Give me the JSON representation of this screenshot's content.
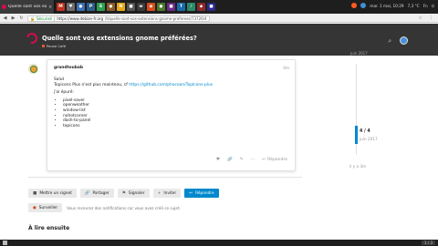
{
  "browser": {
    "tab_title": "Quelle sont vos extensions",
    "tab_close": "×",
    "pinned": [
      {
        "label": "M",
        "color": "#c23321"
      },
      {
        "label": "♥",
        "color": "#6d6d6d"
      },
      {
        "label": "●",
        "color": "#3c6eb4"
      },
      {
        "label": "P",
        "color": "#2d5f8a"
      },
      {
        "label": "S",
        "color": "#2e9e4f"
      },
      {
        "label": "●",
        "color": "#8a5a2a"
      },
      {
        "label": "N",
        "color": "#e6a817"
      },
      {
        "label": "■",
        "color": "#555555"
      },
      {
        "label": "w",
        "color": "#3a3a3a"
      },
      {
        "label": "◉",
        "color": "#d64d1a"
      },
      {
        "label": "●",
        "color": "#4a7a2a"
      },
      {
        "label": "■",
        "color": "#6a2a8a"
      },
      {
        "label": "T",
        "color": "#1a6aaa"
      },
      {
        "label": "♪",
        "color": "#2a8a6a"
      },
      {
        "label": "◆",
        "color": "#8a2a2a"
      },
      {
        "label": "■",
        "color": "#2a2a8a"
      }
    ],
    "status": {
      "clock": "mar. 1 mai, 10:29",
      "temperature": "7,3 °C",
      "layout": "Fn"
    },
    "back": "◀",
    "forward": "▶",
    "url_secure": "Sécurisé",
    "url_host": "https://www.debian-fr.org",
    "url_path": "/t/quelle-sont-vos-extensions-gnome-preferees/73726/4",
    "star": "☆",
    "menu": "⋮"
  },
  "header": {
    "title": "Quelle sont vos extensions gnome préférées?",
    "category": "Pause Café",
    "category_color": "#e45735",
    "search": "⌕",
    "hamburger": "≡"
  },
  "post": {
    "username": "grandtoubab",
    "date": "4m",
    "line1": "Salut",
    "line2_text": "Topicons Plus n'est plus maintenu, cf ",
    "line2_link": "https://github.com/phocean/TopIcons-plus",
    "line3": "j'ai épuré:",
    "extensions": [
      "pixel-saver",
      "openweather",
      "window-list",
      "nohotcorner",
      "dash-to-panel",
      "topicons"
    ],
    "reply": "Répondre",
    "icon_like": "♥",
    "icon_link": "🔗",
    "icon_edit": "✎",
    "icon_more": "⋯",
    "icon_reply": "↩"
  },
  "timeline": {
    "top_date": "juin 2017",
    "position": "4 / 4",
    "date": "juin 2017",
    "ago": "il y a 3m"
  },
  "footer": {
    "buttons": [
      {
        "icon": "■",
        "label": "Mettre un signet"
      },
      {
        "icon": "🔗",
        "label": "Partager"
      },
      {
        "icon": "⚑",
        "label": "Signaler"
      },
      {
        "icon": "+",
        "label": "Inviter"
      },
      {
        "icon": "↩",
        "label": "Répondre"
      }
    ],
    "notif_label": "Surveiller",
    "notif_icon": "●",
    "notif_text": "Vous recevrez des notifications car vous avez créé ce sujet.",
    "suggested": "À lire ensuite"
  },
  "bottom": {
    "pages": "1 / 3"
  }
}
